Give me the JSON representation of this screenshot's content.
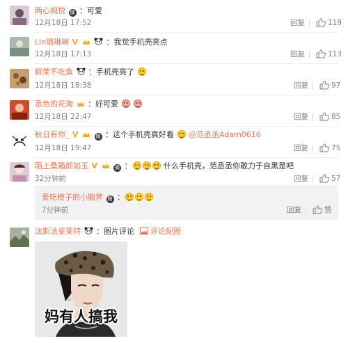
{
  "comments": [
    {
      "name": "两心相悦",
      "content": "：可爱",
      "time": "12月18日 17:52",
      "reply": "回复",
      "likes": "119"
    },
    {
      "name": "Lin璐琳琳",
      "content": "：我觉手机壳亮点",
      "time": "12月18日 17:13",
      "reply": "回复",
      "likes": "113"
    },
    {
      "name": "鲜茉不吃鱼",
      "content": "：手机壳亮了",
      "time": "12月18日 18:38",
      "reply": "回复",
      "likes": "97"
    },
    {
      "name": "丞色的花海",
      "content": "：好可爱",
      "time": "12月18日 22:47",
      "reply": "回复",
      "likes": "85"
    },
    {
      "name": "秋日有你_",
      "content": "：这个手机壳真好看",
      "mention": "@范丞丞Adam0616",
      "time": "12月18日 19:47",
      "reply": "回复",
      "likes": "75"
    },
    {
      "name": "陌上桑箱颜如玉",
      "content": "什么手机壳，范丞丞你敢力于自黑是吧",
      "time": "32分钟前",
      "reply": "回复",
      "likes": "57"
    }
  ],
  "sub_reply": {
    "name": "爱吃橙子的小脑斧",
    "time": "7分钟前",
    "reply": "回复",
    "like_label": "赞"
  },
  "last_comment": {
    "name": "法斯法斐莱特",
    "content": "：图片评论",
    "link_label": "评论配图",
    "caption": "妈有人搞我"
  },
  "colors": {
    "username": "#eb7350",
    "meta": "#808080",
    "divider": "#eeeeee"
  }
}
